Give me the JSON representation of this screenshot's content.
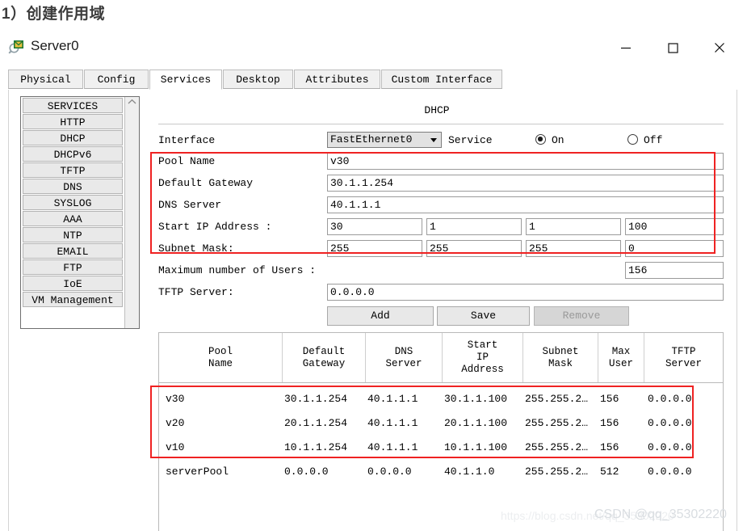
{
  "doc": {
    "heading": "1）创建作用域"
  },
  "window": {
    "title": "Server0",
    "icon": "server-magnifier-icon",
    "controls": {
      "minimize": "minimize-icon",
      "maximize": "maximize-icon",
      "close": "close-icon"
    }
  },
  "tabs": [
    {
      "label": "Physical",
      "active": false
    },
    {
      "label": "Config",
      "active": false
    },
    {
      "label": "Services",
      "active": true
    },
    {
      "label": "Desktop",
      "active": false
    },
    {
      "label": "Attributes",
      "active": false
    },
    {
      "label": "Custom Interface",
      "active": false
    }
  ],
  "sidebar": {
    "items": [
      {
        "label": "SERVICES"
      },
      {
        "label": "HTTP"
      },
      {
        "label": "DHCP"
      },
      {
        "label": "DHCPv6"
      },
      {
        "label": "TFTP"
      },
      {
        "label": "DNS"
      },
      {
        "label": "SYSLOG"
      },
      {
        "label": "AAA"
      },
      {
        "label": "NTP"
      },
      {
        "label": "EMAIL"
      },
      {
        "label": "FTP"
      },
      {
        "label": "IoE"
      },
      {
        "label": "VM Management"
      }
    ],
    "scroll_up": "▲"
  },
  "panel": {
    "title": "DHCP",
    "interface_label": "Interface",
    "interface_value": "FastEthernet0",
    "service_label": "Service",
    "service_on_label": "On",
    "service_off_label": "Off",
    "service_selected": "On",
    "fields": {
      "pool_name_label": "Pool Name",
      "pool_name_value": "v30",
      "default_gateway_label": "Default Gateway",
      "default_gateway_value": "30.1.1.254",
      "dns_server_label": "DNS Server",
      "dns_server_value": "40.1.1.1",
      "start_ip_label": "Start IP Address :",
      "start_ip_octets": [
        "30",
        "1",
        "1",
        "100"
      ],
      "subnet_mask_label": "Subnet Mask:",
      "subnet_mask_octets": [
        "255",
        "255",
        "255",
        "0"
      ],
      "max_users_label": "Maximum number of Users :",
      "max_users_value": "156",
      "tftp_server_label": "TFTP Server:",
      "tftp_server_value": "0.0.0.0"
    },
    "buttons": {
      "add": "Add",
      "save": "Save",
      "remove": "Remove"
    }
  },
  "table": {
    "columns": [
      "Pool\nName",
      "Default\nGateway",
      "DNS\nServer",
      "Start\nIP\nAddress",
      "Subnet\nMask",
      "Max\nUser",
      "TFTP\nServer"
    ],
    "rows": [
      {
        "pool_name": "v30",
        "default_gateway": "30.1.1.254",
        "dns_server": "40.1.1.1",
        "start_ip": "30.1.1.100",
        "subnet_mask": "255.255.2…",
        "max_user": "156",
        "tftp_server": "0.0.0.0"
      },
      {
        "pool_name": "v20",
        "default_gateway": "20.1.1.254",
        "dns_server": "40.1.1.1",
        "start_ip": "20.1.1.100",
        "subnet_mask": "255.255.2…",
        "max_user": "156",
        "tftp_server": "0.0.0.0"
      },
      {
        "pool_name": "v10",
        "default_gateway": "10.1.1.254",
        "dns_server": "40.1.1.1",
        "start_ip": "10.1.1.100",
        "subnet_mask": "255.255.2…",
        "max_user": "156",
        "tftp_server": "0.0.0.0"
      },
      {
        "pool_name": "serverPool",
        "default_gateway": "0.0.0.0",
        "dns_server": "0.0.0.0",
        "start_ip": "40.1.1.0",
        "subnet_mask": "255.255.2…",
        "max_user": "512",
        "tftp_server": "0.0.0.0"
      }
    ]
  },
  "annotations": {
    "highlight_color": "#ef2222"
  },
  "watermark": {
    "blog": "https://blog.csdn.net/qq_35302220",
    "csdn": "CSDN @qq_35302220"
  }
}
